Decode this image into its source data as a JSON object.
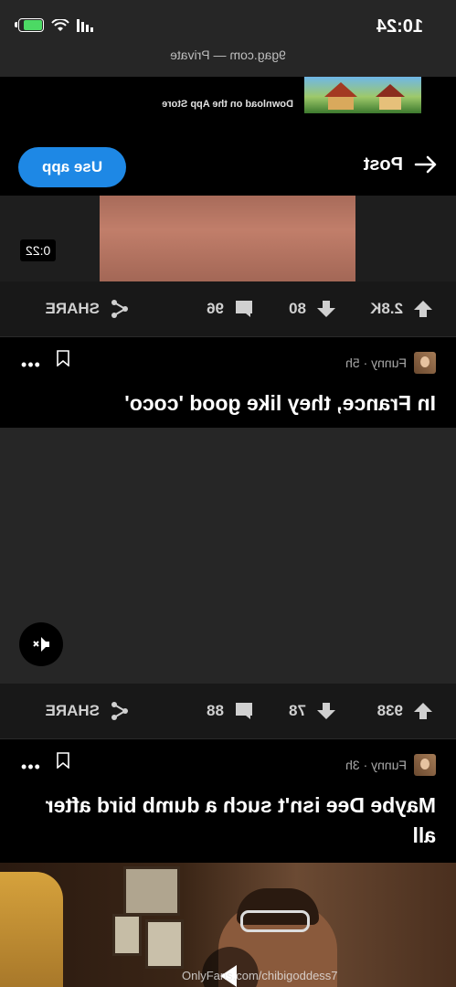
{
  "status": {
    "time": "10:24"
  },
  "browser": {
    "url_label": "9gag.com — Private"
  },
  "ad": {
    "text": "Download on the App Store"
  },
  "header": {
    "title": "Post",
    "use_app_label": "Use app"
  },
  "video1": {
    "duration": "0:22"
  },
  "actions1": {
    "upvotes": "2.8K",
    "downvotes": "80",
    "comments": "96",
    "share": "SHARE"
  },
  "post1": {
    "section": "Funny · 5h",
    "title": "In France, they like good 'coco'"
  },
  "actions2": {
    "upvotes": "938",
    "downvotes": "78",
    "comments": "88",
    "share": "SHARE"
  },
  "post2": {
    "section": "Funny · 3h",
    "title": "Maybe Dee isn't such a dumb bird after all"
  },
  "video3": {
    "watermark": "OnlyFans.com/chibigoddess7"
  }
}
